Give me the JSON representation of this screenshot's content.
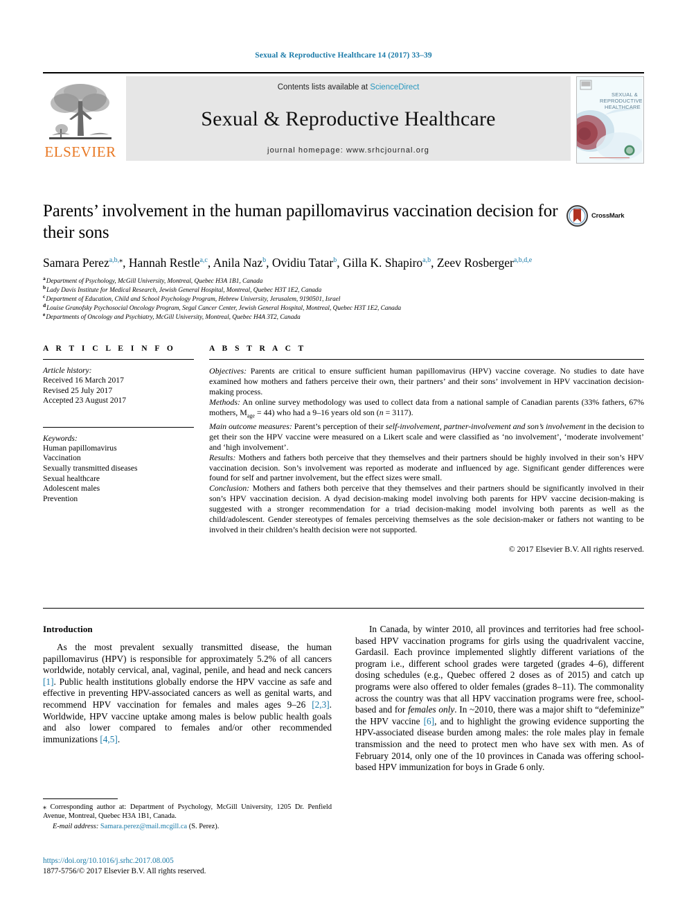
{
  "running_head": "Sexual & Reproductive Healthcare 14 (2017) 33–39",
  "masthead": {
    "publisher": "ELSEVIER",
    "contents_prefix": "Contents lists available at ",
    "contents_link": "ScienceDirect",
    "journal_title": "Sexual & Reproductive Healthcare",
    "homepage": "journal homepage: www.srhcjournal.org",
    "cover_title_line1": "SEXUAL &",
    "cover_title_line2": "REPRODUCTIVE",
    "cover_title_line3": "HEALTHCARE"
  },
  "article": {
    "title": "Parents’ involvement in the human papillomavirus vaccination decision for their sons",
    "crossmark_label": "CrossMark",
    "authors": [
      {
        "name": "Samara Perez",
        "marks": "a,b,",
        "star": true
      },
      {
        "name": "Hannah Restle",
        "marks": "a,c",
        "star": false
      },
      {
        "name": "Anila Naz",
        "marks": "b",
        "star": false
      },
      {
        "name": "Ovidiu Tatar",
        "marks": "b",
        "star": false
      },
      {
        "name": "Gilla K. Shapiro",
        "marks": "a,b",
        "star": false
      },
      {
        "name": "Zeev Rosberger",
        "marks": "a,b,d,e",
        "star": false
      }
    ],
    "affiliations": [
      {
        "mark": "a",
        "text": "Department of Psychology, McGill University, Montreal, Quebec H3A 1B1, Canada"
      },
      {
        "mark": "b",
        "text": "Lady Davis Institute for Medical Research, Jewish General Hospital, Montreal, Quebec H3T 1E2, Canada"
      },
      {
        "mark": "c",
        "text": "Department of Education, Child and School Psychology Program, Hebrew University, Jerusalem, 9190501, Israel"
      },
      {
        "mark": "d",
        "text": "Louise Granofsky Psychosocial Oncology Program, Segal Cancer Center, Jewish General Hospital, Montreal, Quebec H3T 1E2, Canada"
      },
      {
        "mark": "e",
        "text": "Departments of Oncology and Psychiatry, McGill University, Montreal, Quebec H4A 3T2, Canada"
      }
    ]
  },
  "article_info": {
    "heading": "A R T I C L E   I N F O",
    "history_label": "Article history:",
    "history": [
      "Received 16 March 2017",
      "Revised 25 July 2017",
      "Accepted 23 August 2017"
    ],
    "keywords_label": "Keywords:",
    "keywords": [
      "Human papillomavirus",
      "Vaccination",
      "Sexually transmitted diseases",
      "Sexual healthcare",
      "Adolescent males",
      "Prevention"
    ]
  },
  "abstract": {
    "heading": "A B S T R A C T",
    "sections": [
      {
        "label": "Objectives:",
        "text": " Parents are critical to ensure sufficient human papillomavirus (HPV) vaccine coverage. No studies to date have examined how mothers and fathers perceive their own, their partners’ and their sons’ involvement in HPV vaccination decision-making process."
      },
      {
        "label": "Methods:",
        "text": " An online survey methodology was used to collect data from a national sample of Canadian parents (33% fathers, 67% mothers, Mage = 44) who had a 9–16 years old son (n = 3117)."
      },
      {
        "label": "Main outcome measures:",
        "text": " Parent’s perception of their self-involvement, partner-involvement and son’s involvement in the decision to get their son the HPV vaccine were measured on a Likert scale and were classified as ‘no involvement’, ‘moderate involvement’ and ‘high involvement’."
      },
      {
        "label": "Results:",
        "text": " Mothers and fathers both perceive that they themselves and their partners should be highly involved in their son’s HPV vaccination decision. Son’s involvement was reported as moderate and influenced by age. Significant gender differences were found for self and partner involvement, but the effect sizes were small."
      },
      {
        "label": "Conclusion:",
        "text": " Mothers and fathers both perceive that they themselves and their partners should be significantly involved in their son’s HPV vaccination decision. A dyad decision-making model involving both parents for HPV vaccine decision-making is suggested with a stronger recommendation for a triad decision-making model involving both parents as well as the child/adolescent. Gender stereotypes of females perceiving themselves as the sole decision-maker or fathers not wanting to be involved in their children’s health decision were not supported."
      }
    ],
    "copyright": "© 2017 Elsevier B.V. All rights reserved."
  },
  "introduction": {
    "heading": "Introduction",
    "left_paragraph": "As the most prevalent sexually transmitted disease, the human papillomavirus (HPV) is responsible for approximately 5.2% of all cancers worldwide, notably cervical, anal, vaginal, penile, and head and neck cancers [1]. Public health institutions globally endorse the HPV vaccine as safe and effective in preventing HPV-associated cancers as well as genital warts, and recommend HPV vaccination for females and males ages 9–26 [2,3]. Worldwide, HPV vaccine uptake among males is below public health goals and also lower compared to females and/or other recommended immunizations [4,5].",
    "right_paragraph": "In Canada, by winter 2010, all provinces and territories had free school-based HPV vaccination programs for girls using the quadrivalent vaccine, Gardasil. Each province implemented slightly different variations of the program i.e., different school grades were targeted (grades 4–6), different dosing schedules (e.g., Quebec offered 2 doses as of 2015) and catch up programs were also offered to older females (grades 8–11). The commonality across the country was that all HPV vaccination programs were free, school-based and for females only. In ~2010, there was a major shift to “defeminize” the HPV vaccine [6], and to highlight the growing evidence supporting the HPV-associated disease burden among males: the role males play in female transmission and the need to protect men who have sex with men. As of February 2014, only one of the 10 provinces in Canada was offering school-based HPV immunization for boys in Grade 6 only."
  },
  "footnotes": {
    "corresponding": "Corresponding author at: Department of Psychology, McGill University, 1205 Dr. Penfield Avenue, Montreal, Quebec H3A 1B1, Canada.",
    "email_label": "E-mail address:",
    "email": "Samara.perez@mail.mcgill.ca",
    "email_owner": " (S. Perez).",
    "doi": "https://doi.org/10.1016/j.srhc.2017.08.005",
    "issn_line": "1877-5756/© 2017 Elsevier B.V. All rights reserved."
  },
  "colors": {
    "link_blue": "#1a7aa8",
    "sciencedirect_blue": "#2596be",
    "elsevier_orange": "#E87722",
    "band_gray": "#e6e6e6"
  }
}
